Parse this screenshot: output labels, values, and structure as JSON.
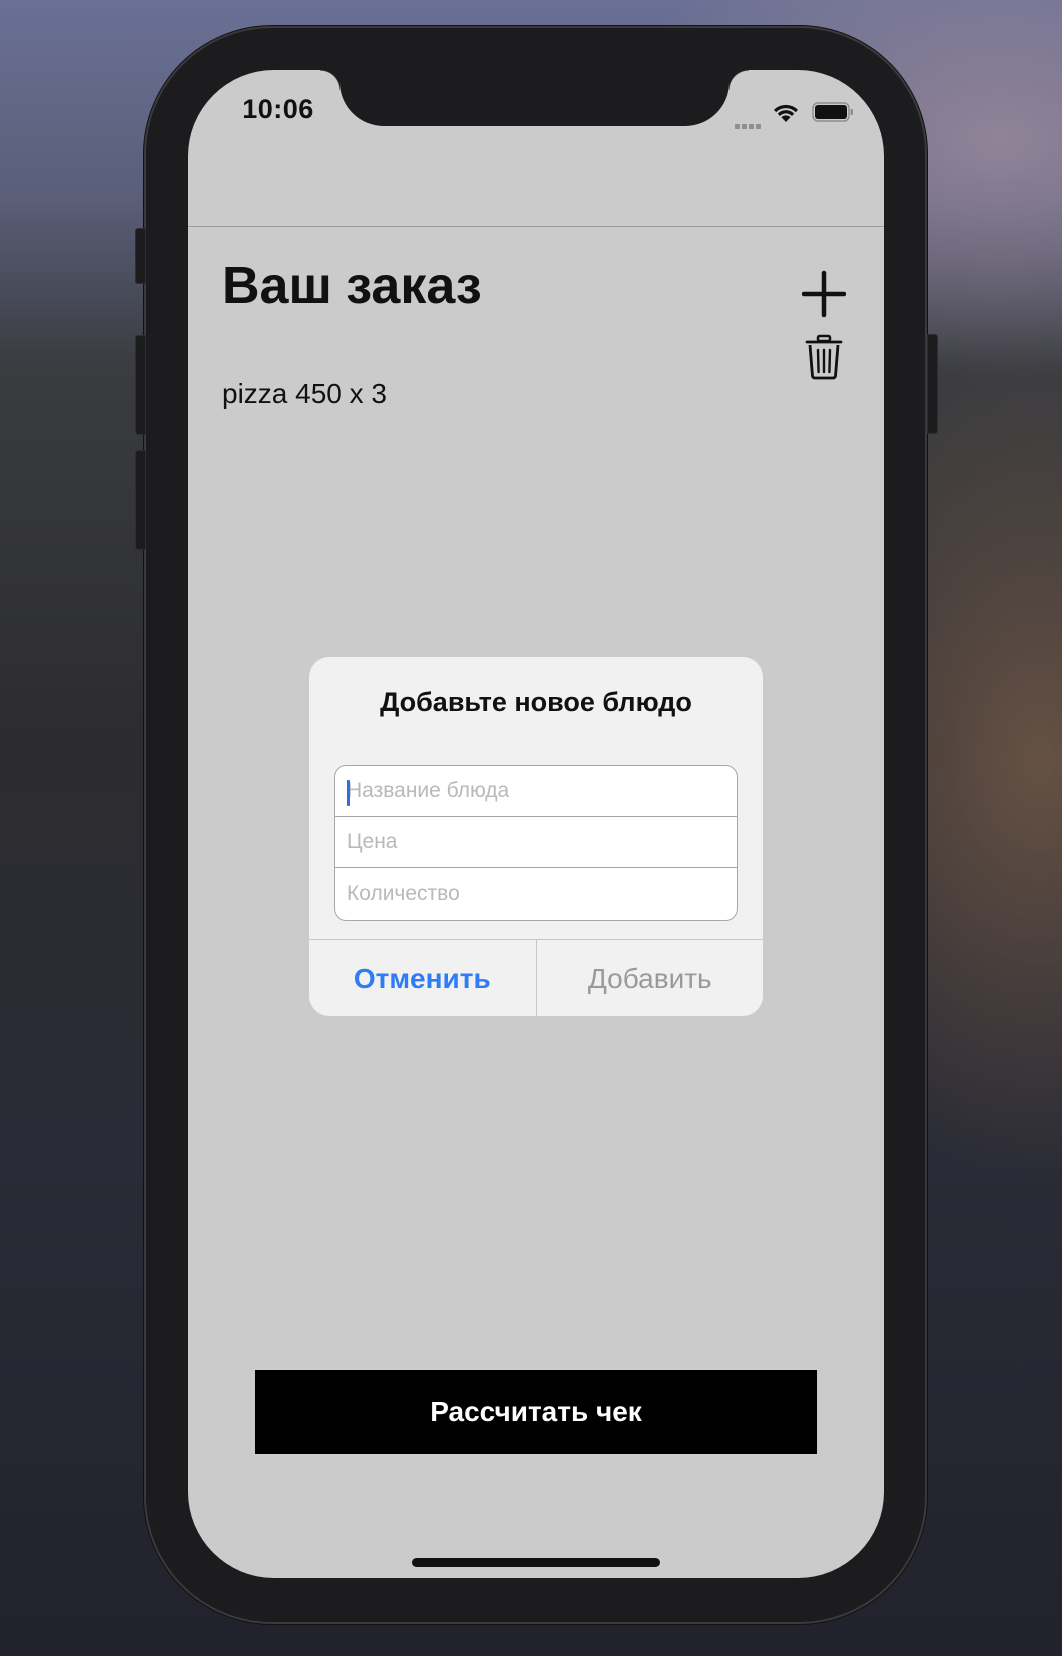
{
  "status_bar": {
    "time": "10:06"
  },
  "header": {
    "title": "Ваш заказ",
    "add_icon": "plus-icon",
    "delete_icon": "trash-icon"
  },
  "order": {
    "items": [
      "pizza 450 x 3"
    ]
  },
  "alert": {
    "title": "Добавьте новое блюдо",
    "fields": [
      {
        "placeholder": "Название блюда",
        "value": ""
      },
      {
        "placeholder": "Цена",
        "value": ""
      },
      {
        "placeholder": "Количество",
        "value": ""
      }
    ],
    "cancel_label": "Отменить",
    "add_label": "Добавить"
  },
  "footer": {
    "calculate_label": "Рассчитать чек"
  },
  "colors": {
    "accent": "#2f7cf6",
    "screen_bg": "#cbcbcb",
    "button_bg": "#000000"
  }
}
